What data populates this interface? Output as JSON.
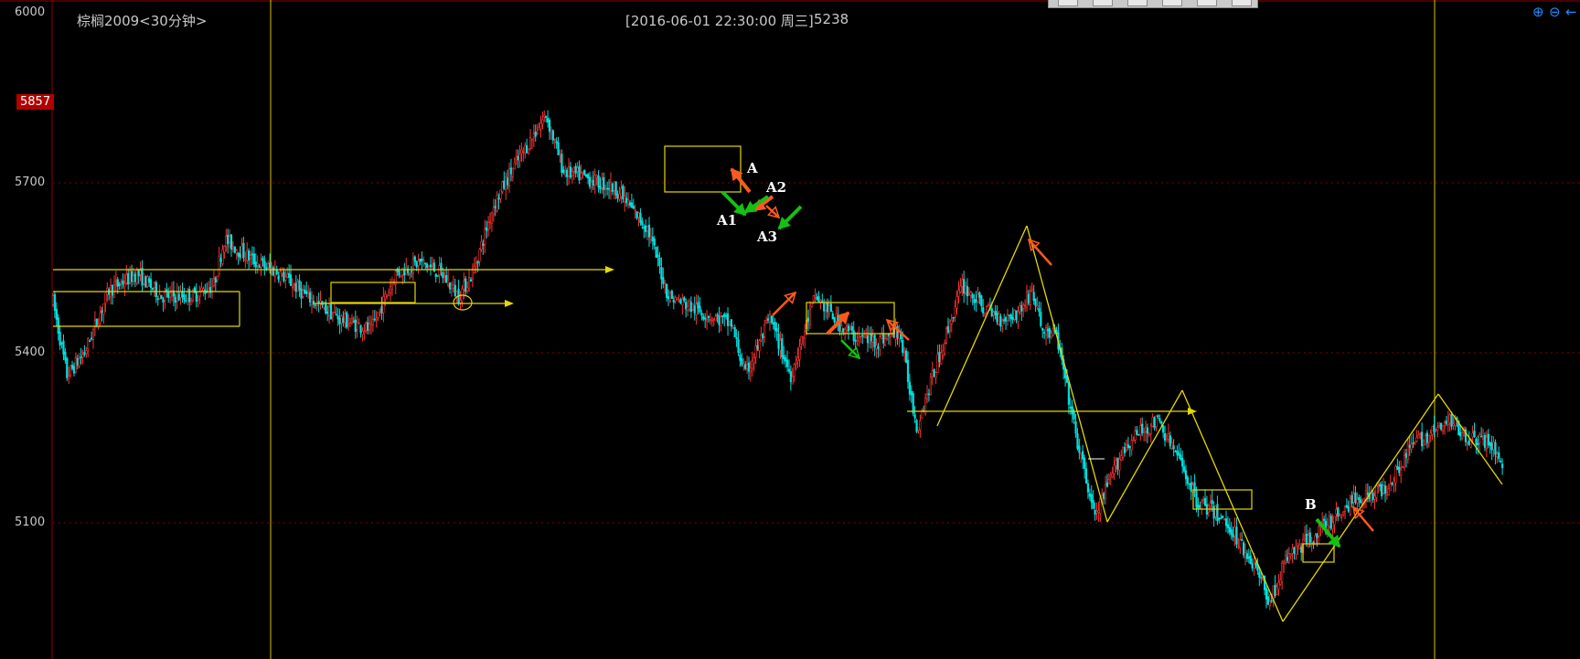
{
  "header": {
    "title": "棕榈2009<30分钟>",
    "datetime": "[2016-06-01  22:30:00 周三]",
    "value": "5238"
  },
  "price_tag": "5857",
  "zoom": {
    "in_icon": "zoom-in-icon",
    "out_icon": "zoom-out-icon",
    "back_icon": "arrow-left-icon"
  },
  "annotations": {
    "A": "A",
    "A1": "A1",
    "A2": "A2",
    "A3": "A3",
    "B": "B"
  },
  "colors": {
    "up": "#ff3333",
    "down": "#00e0e0",
    "line": "#e6d800",
    "grid": "#8b0000",
    "arrow_orange": "#ff5a1e",
    "arrow_green": "#13c013"
  },
  "chart_data": {
    "type": "candlestick",
    "title": "棕榈2009<30分钟>",
    "ylim": [
      4890,
      6000
    ],
    "y_ticks": [
      6000,
      5700,
      5400,
      5100
    ],
    "y_tick_labels": [
      "6000",
      "5700",
      "5400",
      "5100"
    ],
    "series_anchor_points": [
      [
        0,
        5490
      ],
      [
        8,
        5360
      ],
      [
        18,
        5400
      ],
      [
        32,
        5510
      ],
      [
        48,
        5540
      ],
      [
        62,
        5500
      ],
      [
        80,
        5500
      ],
      [
        92,
        5520
      ],
      [
        98,
        5600
      ],
      [
        116,
        5560
      ],
      [
        130,
        5540
      ],
      [
        145,
        5500
      ],
      [
        164,
        5460
      ],
      [
        182,
        5440
      ],
      [
        196,
        5540
      ],
      [
        210,
        5560
      ],
      [
        222,
        5540
      ],
      [
        232,
        5500
      ],
      [
        240,
        5540
      ],
      [
        252,
        5660
      ],
      [
        262,
        5720
      ],
      [
        270,
        5760
      ],
      [
        282,
        5820
      ],
      [
        292,
        5720
      ],
      [
        304,
        5710
      ],
      [
        312,
        5700
      ],
      [
        322,
        5690
      ],
      [
        332,
        5650
      ],
      [
        340,
        5620
      ],
      [
        352,
        5500
      ],
      [
        372,
        5470
      ],
      [
        388,
        5450
      ],
      [
        396,
        5360
      ],
      [
        410,
        5460
      ],
      [
        422,
        5360
      ],
      [
        436,
        5500
      ],
      [
        450,
        5450
      ],
      [
        458,
        5430
      ],
      [
        472,
        5420
      ],
      [
        484,
        5440
      ],
      [
        494,
        5270
      ],
      [
        520,
        5520
      ],
      [
        532,
        5480
      ],
      [
        542,
        5460
      ],
      [
        552,
        5470
      ],
      [
        560,
        5510
      ],
      [
        566,
        5440
      ],
      [
        574,
        5430
      ],
      [
        586,
        5240
      ],
      [
        596,
        5110
      ],
      [
        612,
        5230
      ],
      [
        622,
        5260
      ],
      [
        632,
        5280
      ],
      [
        646,
        5200
      ],
      [
        654,
        5140
      ],
      [
        664,
        5120
      ],
      [
        674,
        5090
      ],
      [
        688,
        5020
      ],
      [
        696,
        4960
      ],
      [
        706,
        5040
      ],
      [
        718,
        5070
      ],
      [
        730,
        5100
      ],
      [
        744,
        5140
      ],
      [
        762,
        5160
      ],
      [
        778,
        5240
      ],
      [
        790,
        5260
      ],
      [
        800,
        5280
      ],
      [
        810,
        5250
      ],
      [
        822,
        5240
      ],
      [
        830,
        5200
      ]
    ]
  }
}
